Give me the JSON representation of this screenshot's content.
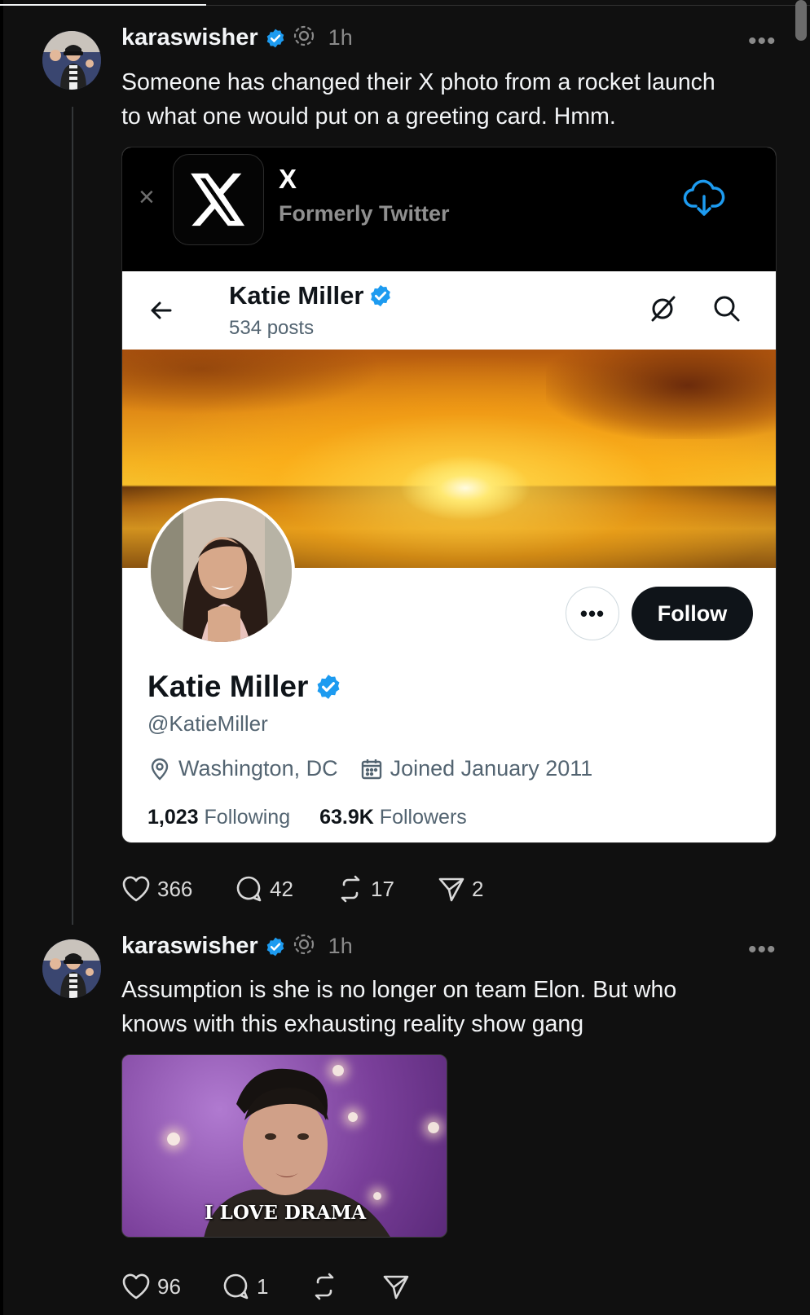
{
  "colors": {
    "background": "#101010",
    "text": "#f3f5f7",
    "muted": "#8a8a8a",
    "verified": "#1d9bf0",
    "follow_button": "#0f1419"
  },
  "posts": [
    {
      "username": "karaswisher",
      "time": "1h",
      "more": "•••",
      "text_line1": "Someone has changed their X photo from a rocket launch",
      "text_line2": "to what one would put on a greeting card. Hmm.",
      "likes": "366",
      "replies": "42",
      "reposts": "17",
      "shares": "2"
    },
    {
      "username": "karaswisher",
      "time": "1h",
      "more": "•••",
      "text_line1": "Assumption is she is no longer on team Elon. But who",
      "text_line2": "knows with this exhausting reality show gang",
      "gif_caption": "I LOVE DRAMA",
      "likes": "96",
      "replies": "1",
      "reposts": "",
      "shares": ""
    }
  ],
  "embed": {
    "banner": {
      "close": "×",
      "app_name": "X",
      "app_subtitle": "Formerly Twitter"
    },
    "nav": {
      "name": "Katie Miller",
      "posts": "534 posts"
    },
    "profile": {
      "dots": "•••",
      "follow": "Follow",
      "name": "Katie Miller",
      "handle": "@KatieMiller",
      "location": "Washington, DC",
      "joined": "Joined January 2011",
      "following_count": "1,023",
      "following_label": "Following",
      "followers_count": "63.9K",
      "followers_label": "Followers"
    }
  }
}
